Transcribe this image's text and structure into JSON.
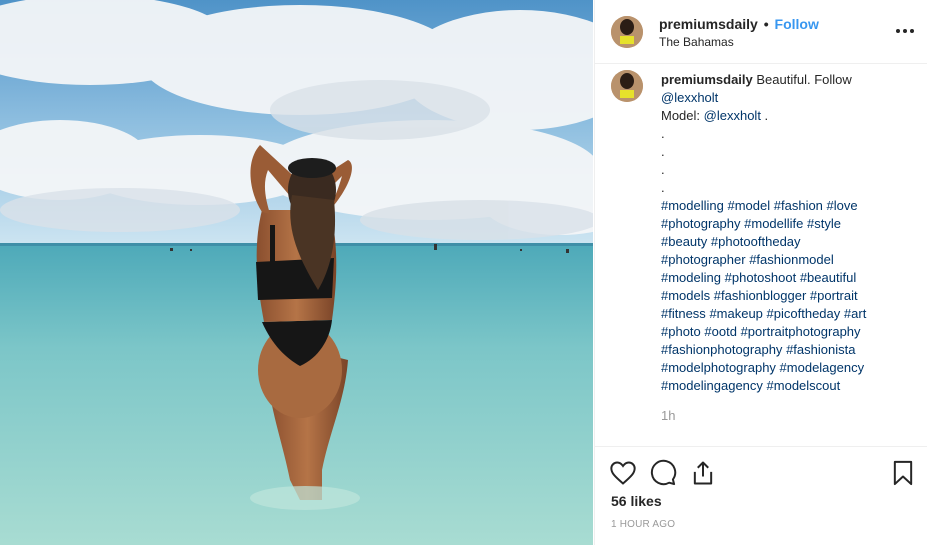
{
  "post": {
    "username": "premiumsdaily",
    "separator": "•",
    "follow_label": "Follow",
    "location": "The Bahamas",
    "photo_alt": "Woman in black bikini standing in shallow turquoise sea under cloudy sky"
  },
  "caption": {
    "username": "premiumsdaily",
    "text1": "Beautiful. Follow",
    "mention1": "@lexxholt",
    "model_label": "Model:",
    "mention2": "@lexxholt",
    "model_suffix": " .",
    "dots": [
      ".",
      ".",
      ".",
      "."
    ],
    "hashtag_lines": [
      [
        "#modelling",
        "#model",
        "#fashion",
        "#love"
      ],
      [
        "#photography",
        "#modellife",
        "#style"
      ],
      [
        "#beauty",
        "#photooftheday"
      ],
      [
        "#photographer",
        "#fashionmodel"
      ],
      [
        "#modeling",
        "#photoshoot",
        "#beautiful"
      ],
      [
        "#models",
        "#fashionblogger",
        "#portrait"
      ],
      [
        "#fitness",
        "#makeup",
        "#picoftheday",
        "#art"
      ],
      [
        "#photo",
        "#ootd",
        "#portraitphotography"
      ],
      [
        "#fashionphotography",
        "#fashionista"
      ],
      [
        "#modelphotography",
        "#modelagency"
      ],
      [
        "#modelingagency",
        "#modelscout"
      ]
    ],
    "time": "1h"
  },
  "actions": {
    "icons": [
      "heart-icon",
      "comment-icon",
      "share-icon",
      "bookmark-icon"
    ],
    "likes": "56 likes",
    "posted_ago": "1 HOUR AGO"
  }
}
